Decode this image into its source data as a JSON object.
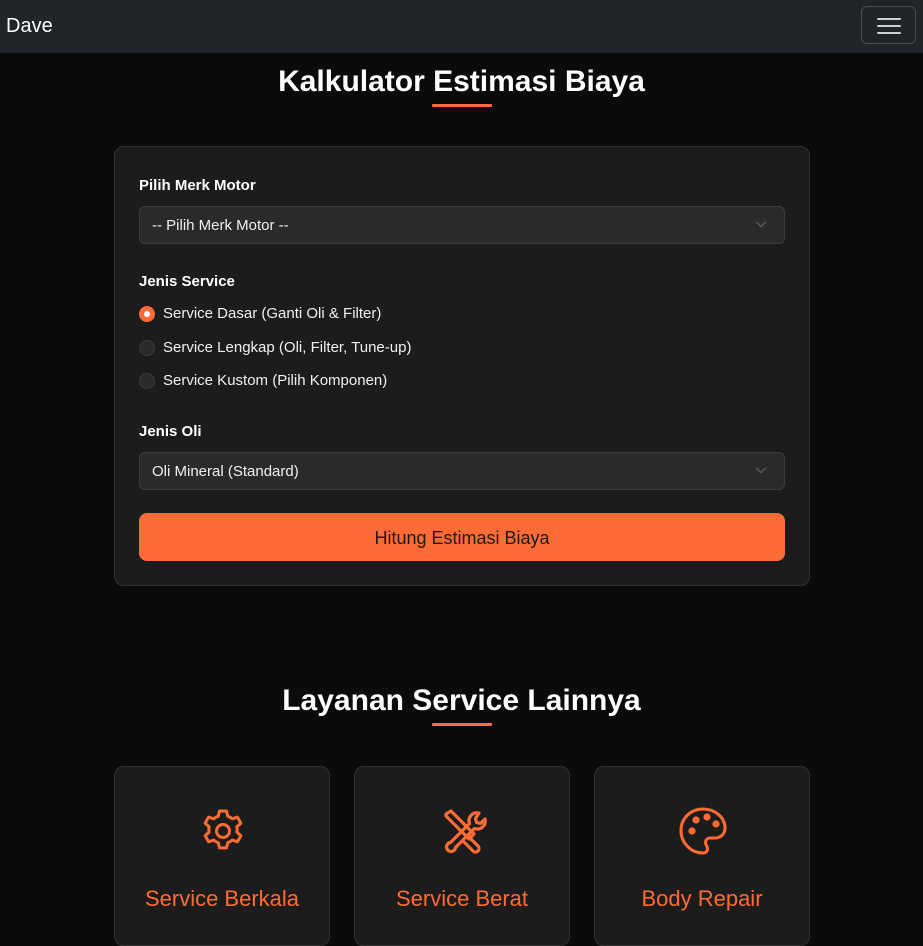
{
  "navbar": {
    "brand": "Dave",
    "toggle_icon": "hamburger-menu-icon"
  },
  "calculator": {
    "title": "Kalkulator Estimasi Biaya",
    "brand_label": "Pilih Merk Motor",
    "brand_selected": "-- Pilih Merk Motor --",
    "service_label": "Jenis Service",
    "service_options": [
      {
        "label": "Service Dasar (Ganti Oli & Filter)",
        "checked": true
      },
      {
        "label": "Service Lengkap (Oli, Filter, Tune-up)",
        "checked": false
      },
      {
        "label": "Service Kustom (Pilih Komponen)",
        "checked": false
      }
    ],
    "oil_label": "Jenis Oli",
    "oil_selected": "Oli Mineral (Standard)",
    "submit_label": "Hitung Estimasi Biaya"
  },
  "services": {
    "title": "Layanan Service Lainnya",
    "cards": [
      {
        "title": "Service Berkala",
        "icon": "gear-icon"
      },
      {
        "title": "Service Berat",
        "icon": "tools-icon"
      },
      {
        "title": "Body Repair",
        "icon": "palette-icon"
      }
    ]
  },
  "colors": {
    "accent": "#ff6b35",
    "background": "#0b0b0b",
    "navbar": "#212429",
    "card": "#1c1c1c"
  }
}
